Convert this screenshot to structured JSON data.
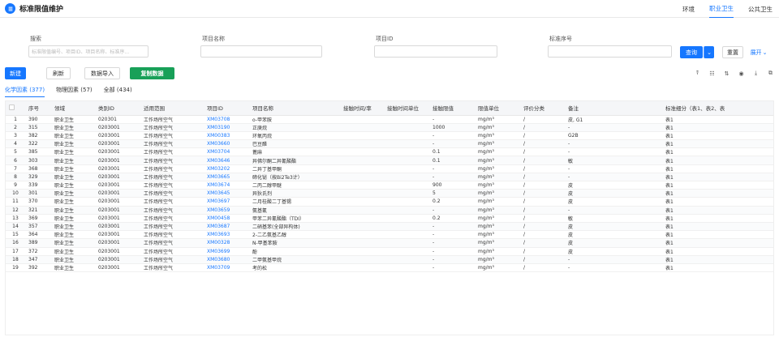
{
  "header": {
    "title": "标准限值维护",
    "tabs": [
      {
        "label": "环境",
        "active": false
      },
      {
        "label": "职业卫生",
        "active": true
      },
      {
        "label": "公共卫生",
        "active": false
      }
    ]
  },
  "filters": {
    "search": {
      "label": "搜索",
      "placeholder": "标准限值编号、项目ID、项目名称、标准序..."
    },
    "item_name": {
      "label": "项目名称",
      "placeholder": ""
    },
    "item_id": {
      "label": "项目ID",
      "placeholder": ""
    },
    "std_no": {
      "label": "标准序号",
      "placeholder": ""
    },
    "query_label": "查询",
    "reset_label": "重置",
    "expand_label": "展开"
  },
  "toolbar": {
    "new_label": "新建",
    "refresh_label": "刷新",
    "import_label": "数据导入",
    "copy_label": "复制数据"
  },
  "subtabs": [
    {
      "label": "化学因素 (377)",
      "active": true
    },
    {
      "label": "物理因素 (57)",
      "active": false
    },
    {
      "label": "全部 (434)",
      "active": false
    }
  ],
  "table": {
    "columns": [
      "",
      "序号",
      "领域",
      "类别ID",
      "适用范围",
      "项目ID",
      "项目名称",
      "接触时间/率",
      "接触时间单位",
      "接触限值",
      "限值单位",
      "评价分类",
      "备注",
      "标准细分（表1、表2、表"
    ],
    "rows": [
      [
        "1",
        "390",
        "职业卫生",
        "020301",
        "工作场所空气",
        "XM03708",
        "o-甲苯胺",
        "",
        "",
        "-",
        "mg/m³",
        "/",
        "皮, G1",
        "表1"
      ],
      [
        "2",
        "315",
        "职业卫生",
        "0203001",
        "工作场所空气",
        "XM03190",
        "正庚烷",
        "",
        "",
        "1000",
        "mg/m³",
        "/",
        "-",
        "表1"
      ],
      [
        "3",
        "382",
        "职业卫生",
        "0203001",
        "工作场所空气",
        "XM00383",
        "环氧丙烷",
        "",
        "",
        "-",
        "mg/m³",
        "/",
        "G2B",
        "表1"
      ],
      [
        "4",
        "322",
        "职业卫生",
        "0203001",
        "工作场所空气",
        "XM03660",
        "巴豆醛",
        "",
        "",
        "-",
        "mg/m³",
        "/",
        "-",
        "表1"
      ],
      [
        "5",
        "385",
        "职业卫生",
        "0203001",
        "工作场所空气",
        "XM03704",
        "蓖麻",
        "",
        "",
        "0.1",
        "mg/m³",
        "/",
        "-",
        "表1"
      ],
      [
        "6",
        "303",
        "职业卫生",
        "0203001",
        "工作场所空气",
        "XM03646",
        "异佛尔酮二异氰酸酯",
        "",
        "",
        "0.1",
        "mg/m³",
        "/",
        "敏",
        "表1"
      ],
      [
        "7",
        "368",
        "职业卫生",
        "0203001",
        "工作场所空气",
        "XM03202",
        "二异丁基甲酮",
        "",
        "",
        "-",
        "mg/m³",
        "/",
        "-",
        "表1"
      ],
      [
        "8",
        "329",
        "职业卫生",
        "0203001",
        "工作场所空气",
        "XM03665",
        "碲化铋（按Bi2Te3计）",
        "",
        "",
        "-",
        "mg/m³",
        "/",
        "-",
        "表1"
      ],
      [
        "9",
        "339",
        "职业卫生",
        "0203001",
        "工作场所空气",
        "XM03674",
        "二丙二醇甲醚",
        "",
        "",
        "900",
        "mg/m³",
        "/",
        "皮",
        "表1"
      ],
      [
        "10",
        "301",
        "职业卫生",
        "0203001",
        "工作场所空气",
        "XM03645",
        "异狄氏剂",
        "",
        "",
        "5",
        "mg/m³",
        "/",
        "皮",
        "表1"
      ],
      [
        "11",
        "370",
        "职业卫生",
        "0203001",
        "工作场所空气",
        "XM03697",
        "二月桂酸二丁基锡",
        "",
        "",
        "0.2",
        "mg/m³",
        "/",
        "皮",
        "表1"
      ],
      [
        "12",
        "321",
        "职业卫生",
        "0203001",
        "工作场所空气",
        "XM03659",
        "氨基氰",
        "",
        "",
        "-",
        "mg/m³",
        "/",
        "-",
        "表1"
      ],
      [
        "13",
        "369",
        "职业卫生",
        "0203001",
        "工作场所空气",
        "XM00458",
        "甲苯二异氰酸酯（TDI）",
        "",
        "",
        "0.2",
        "mg/m³",
        "/",
        "敏",
        "表1"
      ],
      [
        "14",
        "357",
        "职业卫生",
        "0203001",
        "工作场所空气",
        "XM03687",
        "二硝基苯(全部异构体)",
        "",
        "",
        "-",
        "mg/m³",
        "/",
        "皮",
        "表1"
      ],
      [
        "15",
        "364",
        "职业卫生",
        "0203001",
        "工作场所空气",
        "XM03693",
        "2-二乙氨基乙醇",
        "",
        "",
        "-",
        "mg/m³",
        "/",
        "皮",
        "表1"
      ],
      [
        "16",
        "389",
        "职业卫生",
        "0203001",
        "工作场所空气",
        "XM00328",
        "N-甲基苯胺",
        "",
        "",
        "-",
        "mg/m³",
        "/",
        "皮",
        "表1"
      ],
      [
        "17",
        "372",
        "职业卫生",
        "0203001",
        "工作场所空气",
        "XM03699",
        "酚",
        "",
        "",
        "-",
        "mg/m³",
        "/",
        "皮",
        "表1"
      ],
      [
        "18",
        "347",
        "职业卫生",
        "0203001",
        "工作场所空气",
        "XM03680",
        "二甲氨基甲烷",
        "",
        "",
        "-",
        "mg/m³",
        "/",
        "-",
        "表1"
      ],
      [
        "19",
        "392",
        "职业卫生",
        "0203001",
        "工作场所空气",
        "XM03709",
        "考的松",
        "",
        "",
        "-",
        "mg/m³",
        "/",
        "-",
        "表1"
      ]
    ]
  },
  "colors": {
    "primary": "#1677ff",
    "green": "#18a058"
  },
  "icons": [
    "app-logo-icon",
    "column-filter-icon",
    "column-settings-icon",
    "sort-icon",
    "eye-icon",
    "download-icon",
    "copy-icon",
    "chevron-down-icon"
  ]
}
